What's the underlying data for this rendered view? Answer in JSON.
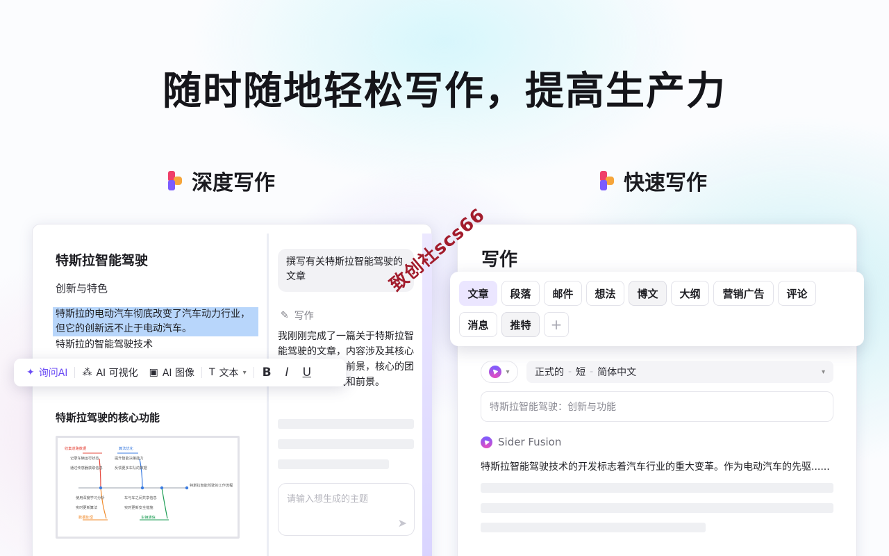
{
  "headline": "随时随地轻松写作，提高生产力",
  "sections": {
    "deep": "深度写作",
    "quick": "快速写作"
  },
  "doc": {
    "title": "特斯拉智能驾驶",
    "subtitle": "创新与特色",
    "highlighted_text": "特斯拉的电动汽车彻底改变了汽车动力行业，但它的创新远不止于电动汽车。",
    "line2": "特斯拉的智能驾驶技术",
    "heading2": "特斯拉驾驶的核心功能"
  },
  "toolbar": {
    "ask_ai": "询问AI",
    "ai_visualize": "AI  可视化",
    "ai_image": "AI  图像",
    "text": "文本",
    "bold": "B",
    "italic": "I",
    "underline": "U"
  },
  "chat": {
    "user_prompt": "撰写有关特斯拉智能驾驶的文章",
    "write_label": "写作",
    "answer": "我刚刚完成了一篇关于特斯拉智能驾驶的文章，内容涉及其核心技术以及挑战和前景，核心的团队介绍以及挑战和前景。",
    "input_placeholder": "请输入想生成的主题"
  },
  "watermark": "致创社scs66",
  "quick_writer": {
    "title": "写作",
    "tags_row1": [
      "文章",
      "段落",
      "邮件",
      "想法",
      "博文",
      "大纲",
      "营销广告",
      "评论"
    ],
    "tags_row2": [
      "消息",
      "推特"
    ],
    "plus": "+",
    "selected_tag": "文章",
    "options": {
      "tone": "正式的",
      "length": "短",
      "language": "简体中文"
    },
    "topic_value": "特斯拉智能驾驶：创新与功能",
    "model_name": "Sider Fusion",
    "output": "特斯拉智能驾驶技术的开发标志着汽车行业的重大变革。作为电动汽车的先驱......"
  },
  "mindmap": {
    "center": "特斯拉智能驾驶的工作流程",
    "branches": [
      {
        "label": "收集道路数据",
        "color": "#e5483d",
        "items": [
          "记录车辆运行状态",
          "通过传感器获取信息"
        ]
      },
      {
        "label": "算法优化",
        "color": "#3a7be0",
        "items": [
          "提升智能决策能力",
          "反馈更多车队的数据"
        ]
      },
      {
        "label": "数据处理",
        "color": "#f08a2a",
        "items": [
          "使用深度学习分析",
          "实时更新算法"
        ]
      },
      {
        "label": "车辆通信",
        "color": "#1e9e55",
        "items": [
          "车与车之间共享信息",
          "实时更新安全措施"
        ]
      }
    ]
  },
  "colors": {
    "accent": "#6b4cf5",
    "highlight": "#b8d6fb",
    "watermark": "#a21c2c"
  }
}
